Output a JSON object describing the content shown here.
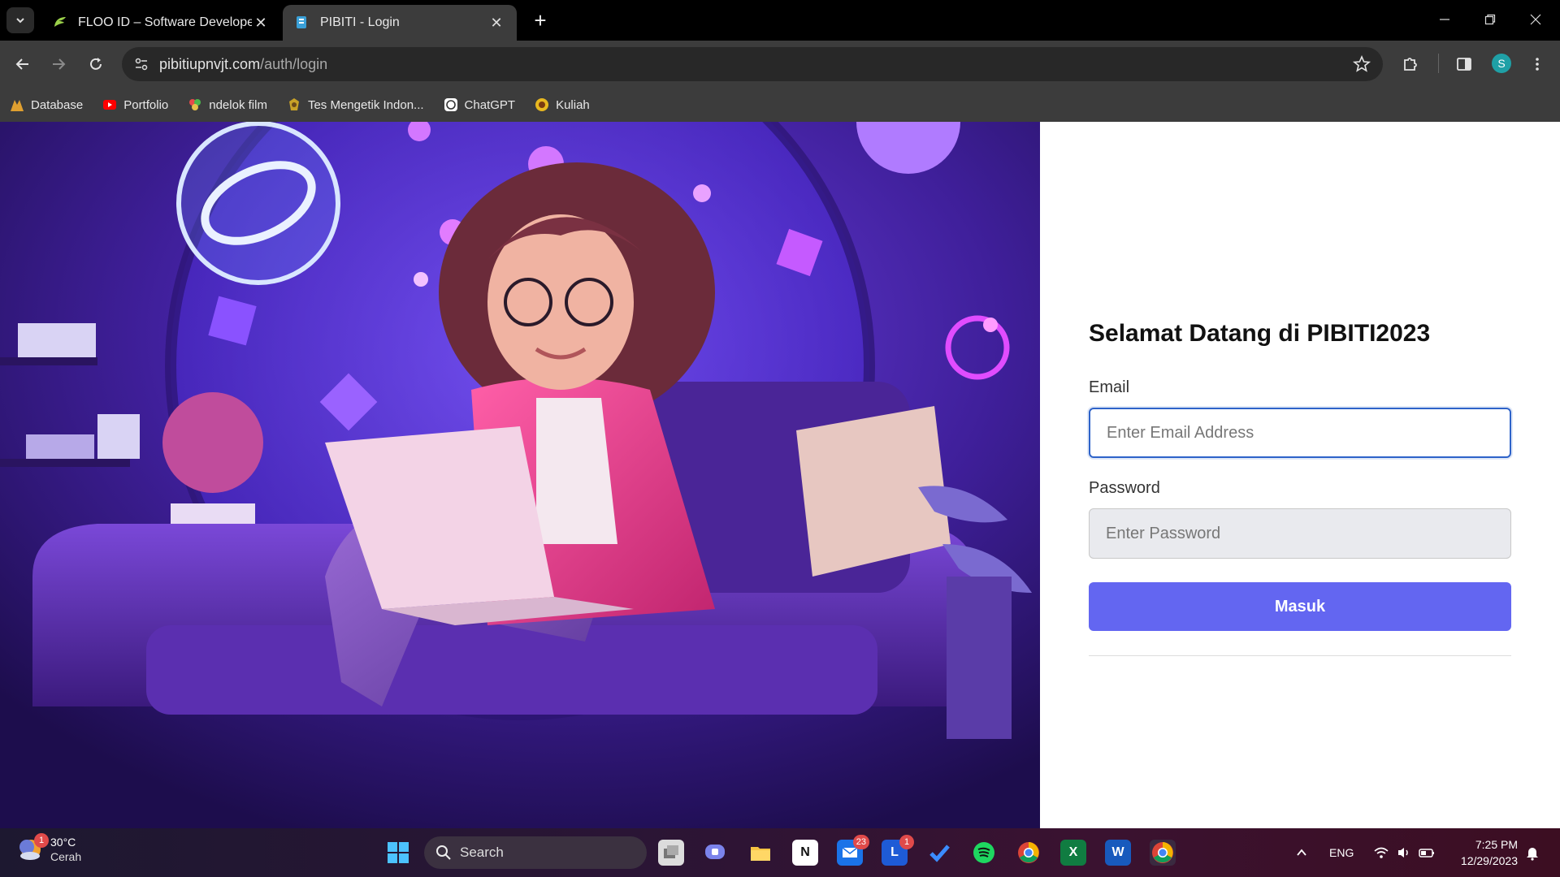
{
  "browser": {
    "tabs": [
      {
        "title": "FLOO ID – Software Developer",
        "active": false
      },
      {
        "title": "PIBITI - Login",
        "active": true
      }
    ],
    "url_host": "pibitiupnvjt.com",
    "url_path": "/auth/login",
    "profile_initial": "S",
    "bookmarks": [
      {
        "label": "Database",
        "icon": "database-icon"
      },
      {
        "label": "Portfolio",
        "icon": "youtube-icon"
      },
      {
        "label": "ndelok film",
        "icon": "film-icon"
      },
      {
        "label": "Tes Mengetik Indon...",
        "icon": "typing-icon"
      },
      {
        "label": "ChatGPT",
        "icon": "chatgpt-icon"
      },
      {
        "label": "Kuliah",
        "icon": "university-icon"
      }
    ]
  },
  "login": {
    "title": "Selamat Datang di PIBITI2023",
    "email_label": "Email",
    "email_placeholder": "Enter Email Address",
    "password_label": "Password",
    "password_placeholder": "Enter Password",
    "submit_label": "Masuk"
  },
  "taskbar": {
    "weather_temp": "30°C",
    "weather_condition": "Cerah",
    "weather_badge": "1",
    "search_label": "Search",
    "mail_badge": "23",
    "l_badge": "1",
    "language": "ENG",
    "time": "7:25 PM",
    "date": "12/29/2023"
  },
  "colors": {
    "accent": "#6366f1",
    "focus_border": "#2e63c9"
  }
}
